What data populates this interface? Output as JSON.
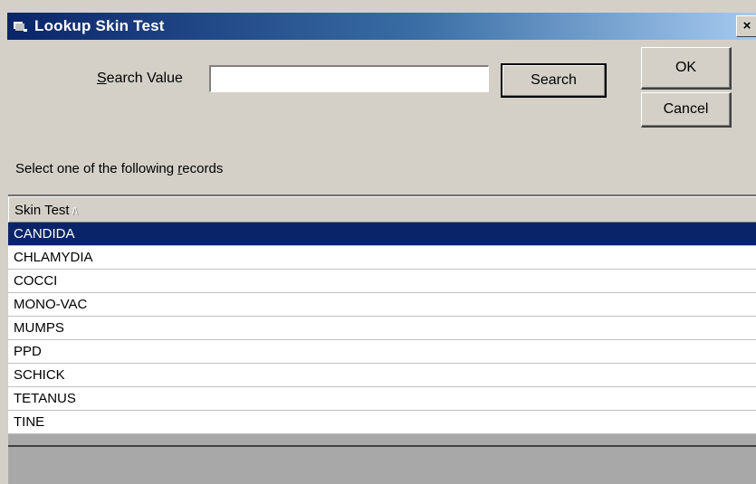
{
  "window": {
    "title": "Lookup Skin Test",
    "close_glyph": "×"
  },
  "search": {
    "label_mnemonic": "S",
    "label_rest": "earch Value",
    "value": "",
    "placeholder": "",
    "button_label": "Search"
  },
  "buttons": {
    "ok_label": "OK",
    "cancel_label": "Cancel"
  },
  "instruction": {
    "prefix": "Select one of the following ",
    "mnemonic": "r",
    "suffix": "ecords"
  },
  "list": {
    "column_header": "Skin Test",
    "sort_glyph": "/\\",
    "selected_index": 0,
    "rows": [
      "CANDIDA",
      "CHLAMYDIA",
      "COCCI",
      "MONO-VAC",
      "MUMPS",
      "PPD",
      "SCHICK",
      "TETANUS",
      "TINE"
    ]
  },
  "colors": {
    "titlebar_start": "#0a246a",
    "selection": "#0a246a",
    "window_bg": "#d4d0c8"
  }
}
